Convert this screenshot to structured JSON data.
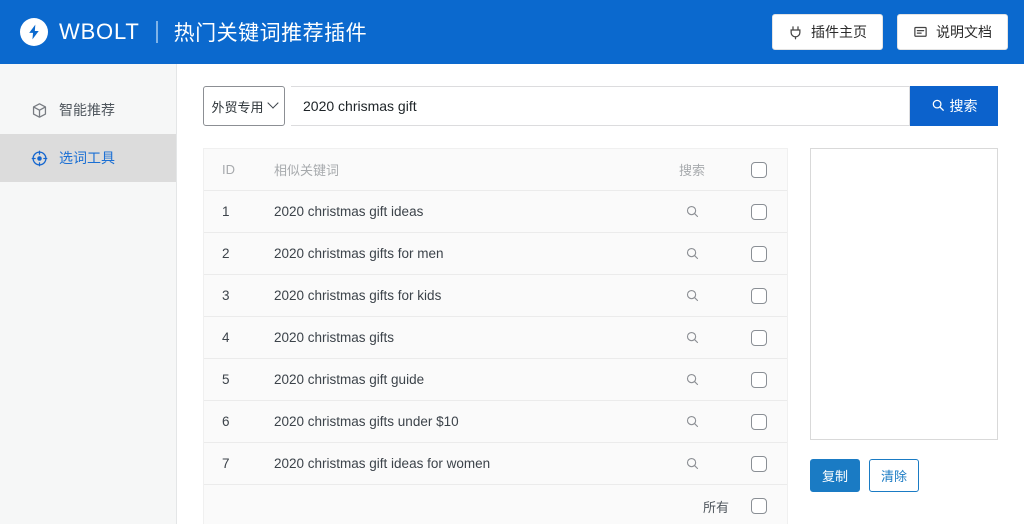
{
  "header": {
    "brand_name": "WBOLT",
    "app_title": "热门关键词推荐插件",
    "logo_icon": "lightning-bolt-icon",
    "actions": [
      {
        "label": "插件主页",
        "icon": "plugin-icon"
      },
      {
        "label": "说明文档",
        "icon": "document-icon"
      }
    ],
    "accent_color": "#0b69ce"
  },
  "sidebar": {
    "items": [
      {
        "label": "智能推荐",
        "icon": "cube-icon",
        "active": false
      },
      {
        "label": "选词工具",
        "icon": "target-icon",
        "active": true
      }
    ],
    "active_color": "#1a6fd4",
    "active_bg": "#dcdcdc"
  },
  "search": {
    "select_value": "外贸专用",
    "input_value": "2020 chrismas gift",
    "input_placeholder": "",
    "button_label": "搜索",
    "button_icon": "search-icon",
    "button_color": "#0c62cc"
  },
  "table": {
    "columns": [
      "ID",
      "相似关键词",
      "搜索",
      ""
    ],
    "rows": [
      {
        "id": "1",
        "keyword": "2020 christmas gift ideas"
      },
      {
        "id": "2",
        "keyword": "2020 christmas gifts for men"
      },
      {
        "id": "3",
        "keyword": "2020 christmas gifts for kids"
      },
      {
        "id": "4",
        "keyword": "2020 christmas gifts"
      },
      {
        "id": "5",
        "keyword": "2020 christmas gift guide"
      },
      {
        "id": "6",
        "keyword": "2020 christmas gifts under $10"
      },
      {
        "id": "7",
        "keyword": "2020 christmas gift ideas for women"
      }
    ],
    "footer_label": "所有",
    "row_action_icon": "search-icon"
  },
  "panel": {
    "textarea_value": "",
    "textarea_placeholder": "",
    "copy_label": "复制",
    "clear_label": "清除",
    "button_color": "#1a7bc4"
  }
}
